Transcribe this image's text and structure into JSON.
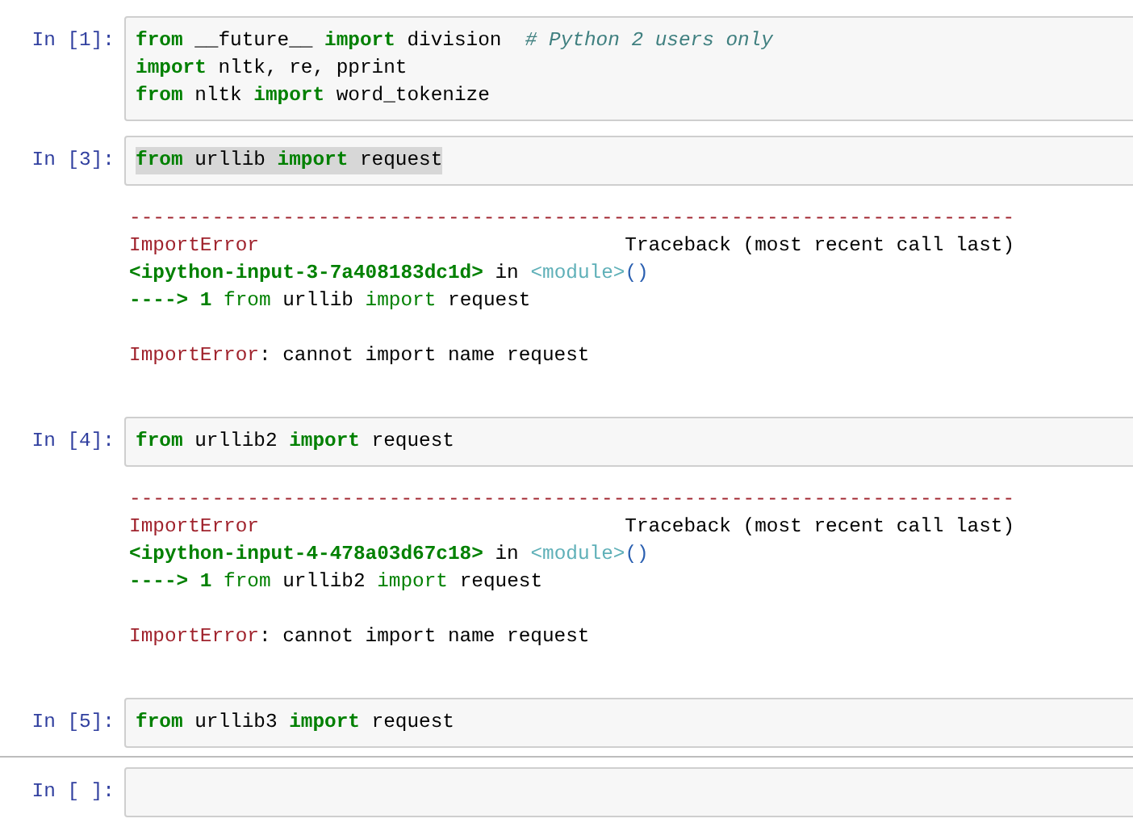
{
  "cells": [
    {
      "prompt": "In [1]:",
      "highlighted": false,
      "divider_above": false,
      "code": [
        [
          {
            "kind": "keyword",
            "text": "from"
          },
          {
            "kind": "plain",
            "text": " __future__ "
          },
          {
            "kind": "keyword",
            "text": "import"
          },
          {
            "kind": "plain",
            "text": " division  "
          },
          {
            "kind": "comment",
            "text": "# Python 2 users only"
          }
        ],
        [
          {
            "kind": "keyword",
            "text": "import"
          },
          {
            "kind": "plain",
            "text": " nltk, re, pprint"
          }
        ],
        [
          {
            "kind": "keyword",
            "text": "from"
          },
          {
            "kind": "plain",
            "text": " nltk "
          },
          {
            "kind": "keyword",
            "text": "import"
          },
          {
            "kind": "plain",
            "text": " word_tokenize"
          }
        ]
      ]
    },
    {
      "prompt": "In [3]:",
      "highlighted": true,
      "divider_above": false,
      "code": [
        [
          {
            "kind": "keyword",
            "text": "from"
          },
          {
            "kind": "plain",
            "text": " urllib "
          },
          {
            "kind": "keyword",
            "text": "import"
          },
          {
            "kind": "plain",
            "text": " request"
          }
        ]
      ],
      "output": [
        {
          "kind": "rule",
          "tokens": [
            {
              "kind": "error",
              "text": "---------------------------------------------------------------------------"
            }
          ]
        },
        {
          "kind": "header",
          "tokens": [
            {
              "kind": "error",
              "text": "ImportError"
            },
            {
              "kind": "plain",
              "text": "Traceback (most recent call last)"
            }
          ]
        },
        {
          "kind": "text",
          "tokens": [
            {
              "kind": "keyword",
              "text": "<ipython-input-3-7a408183dc1d>"
            },
            {
              "kind": "plain",
              "text": " in "
            },
            {
              "kind": "module",
              "text": "<module>"
            },
            {
              "kind": "paren",
              "text": "()"
            }
          ]
        },
        {
          "kind": "text",
          "tokens": [
            {
              "kind": "keyword",
              "text": "----> 1 "
            },
            {
              "kind": "keyword-light",
              "text": "from"
            },
            {
              "kind": "plain",
              "text": " urllib "
            },
            {
              "kind": "keyword-light",
              "text": "import"
            },
            {
              "kind": "plain",
              "text": " request"
            }
          ]
        },
        {
          "kind": "message",
          "tokens": [
            {
              "kind": "error",
              "text": "ImportError"
            },
            {
              "kind": "plain",
              "text": ": cannot import name request"
            }
          ]
        }
      ]
    },
    {
      "prompt": "In [4]:",
      "highlighted": false,
      "divider_above": false,
      "code": [
        [
          {
            "kind": "keyword",
            "text": "from"
          },
          {
            "kind": "plain",
            "text": " urllib2 "
          },
          {
            "kind": "keyword",
            "text": "import"
          },
          {
            "kind": "plain",
            "text": " request"
          }
        ]
      ],
      "output": [
        {
          "kind": "rule",
          "tokens": [
            {
              "kind": "error",
              "text": "---------------------------------------------------------------------------"
            }
          ]
        },
        {
          "kind": "header",
          "tokens": [
            {
              "kind": "error",
              "text": "ImportError"
            },
            {
              "kind": "plain",
              "text": "Traceback (most recent call last)"
            }
          ]
        },
        {
          "kind": "text",
          "tokens": [
            {
              "kind": "keyword",
              "text": "<ipython-input-4-478a03d67c18>"
            },
            {
              "kind": "plain",
              "text": " in "
            },
            {
              "kind": "module",
              "text": "<module>"
            },
            {
              "kind": "paren",
              "text": "()"
            }
          ]
        },
        {
          "kind": "text",
          "tokens": [
            {
              "kind": "keyword",
              "text": "----> 1 "
            },
            {
              "kind": "keyword-light",
              "text": "from"
            },
            {
              "kind": "plain",
              "text": " urllib2 "
            },
            {
              "kind": "keyword-light",
              "text": "import"
            },
            {
              "kind": "plain",
              "text": " request"
            }
          ]
        },
        {
          "kind": "message",
          "tokens": [
            {
              "kind": "error",
              "text": "ImportError"
            },
            {
              "kind": "plain",
              "text": ": cannot import name request"
            }
          ]
        }
      ]
    },
    {
      "prompt": "In [5]:",
      "highlighted": false,
      "divider_above": false,
      "code": [
        [
          {
            "kind": "keyword",
            "text": "from"
          },
          {
            "kind": "plain",
            "text": " urllib3 "
          },
          {
            "kind": "keyword",
            "text": "import"
          },
          {
            "kind": "plain",
            "text": " request"
          }
        ]
      ]
    },
    {
      "prompt": "In [ ]:",
      "highlighted": false,
      "divider_above": true
    }
  ]
}
